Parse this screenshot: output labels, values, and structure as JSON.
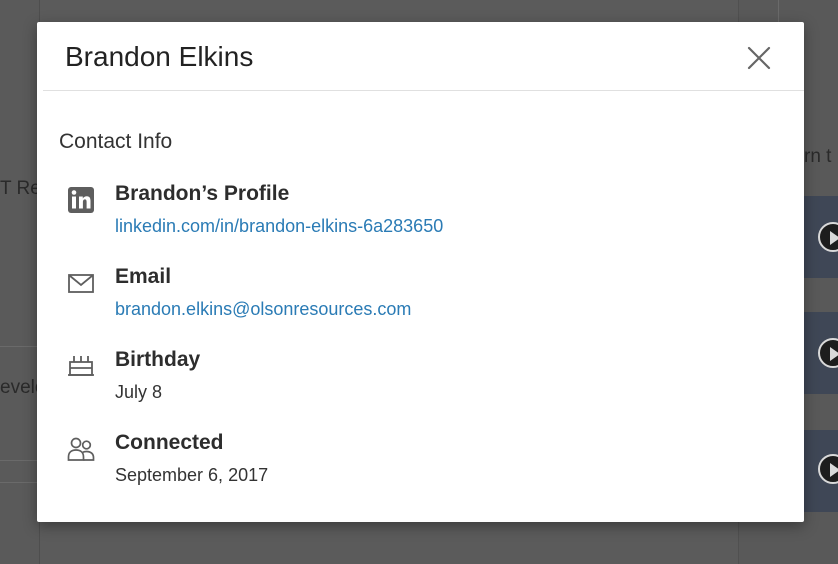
{
  "background": {
    "left_text_1": "T Re",
    "left_text_2": "evelo",
    "right_text": "rn t"
  },
  "modal": {
    "title": "Brandon Elkins",
    "close_label": "×",
    "section_title": "Contact Info",
    "items": [
      {
        "label": "Brandon’s Profile",
        "value": "linkedin.com/in/brandon-elkins-6a283650",
        "link": true,
        "icon": "linkedin-icon"
      },
      {
        "label": "Email",
        "value": "brandon.elkins@olsonresources.com",
        "link": true,
        "icon": "envelope-icon"
      },
      {
        "label": "Birthday",
        "value": "July 8",
        "link": false,
        "icon": "cake-icon"
      },
      {
        "label": "Connected",
        "value": "September 6, 2017",
        "link": false,
        "icon": "people-icon"
      }
    ]
  },
  "colors": {
    "link": "#2a7bb5",
    "text": "#2d2d2d",
    "overlay": "#5b5b5b"
  }
}
